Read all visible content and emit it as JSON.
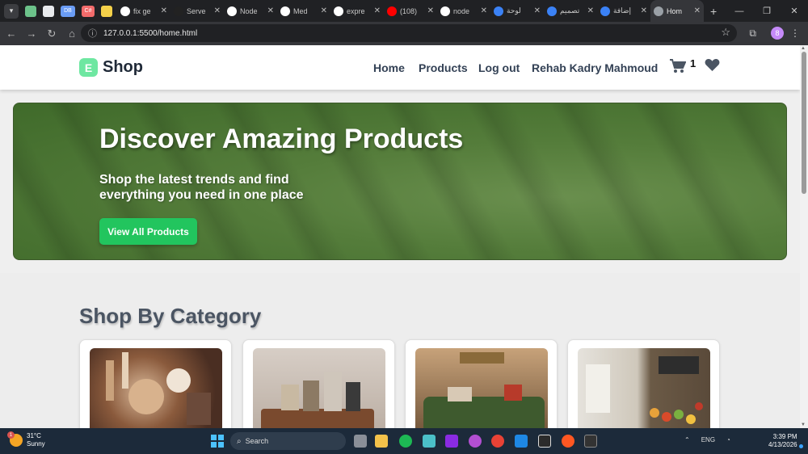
{
  "browser": {
    "tabs": [
      {
        "title": "fix ge",
        "icon": "github-icon",
        "color": "#ffffff"
      },
      {
        "title": "Serve",
        "icon": "server-icon",
        "color": "#222222"
      },
      {
        "title": "Node",
        "icon": "github-icon",
        "color": "#ffffff"
      },
      {
        "title": "Med",
        "icon": "github-icon",
        "color": "#ffffff"
      },
      {
        "title": "expre",
        "icon": "github-icon",
        "color": "#ffffff"
      },
      {
        "title": "(108)",
        "icon": "youtube-icon",
        "color": "#ff0000"
      },
      {
        "title": "node",
        "icon": "github-icon",
        "color": "#ffffff"
      },
      {
        "title": "لوحة",
        "icon": "app-icon",
        "color": "#3b82f6"
      },
      {
        "title": "تصميم",
        "icon": "app-icon",
        "color": "#3b82f6"
      },
      {
        "title": "إضافة",
        "icon": "app-icon",
        "color": "#3b82f6"
      },
      {
        "title": "Hom",
        "icon": "globe-icon",
        "color": "#9aa0a6",
        "active": true
      }
    ],
    "pinned_labels": {
      "db": "DB",
      "cs": "C#"
    },
    "url": "127.0.0.1:5500/home.html",
    "profile_initial": "8"
  },
  "site": {
    "logo_letter": "E",
    "logo_text": "Shop",
    "nav": {
      "home": "Home",
      "products": "Products",
      "logout": "Log out",
      "user": "Rehab Kadry Mahmoud"
    },
    "cart_count": "1"
  },
  "hero": {
    "title": "Discover Amazing Products",
    "subtitle": "Shop the latest trends and find everything you need in one place",
    "button": "View All Products"
  },
  "categories": {
    "title": "Shop By Category"
  },
  "taskbar": {
    "weather_temp": "31°C",
    "weather_desc": "Sunny",
    "weather_badge": "1",
    "search_placeholder": "Search",
    "lang": "ENG",
    "time": "3:39 PM",
    "date": "4/13/2026"
  }
}
